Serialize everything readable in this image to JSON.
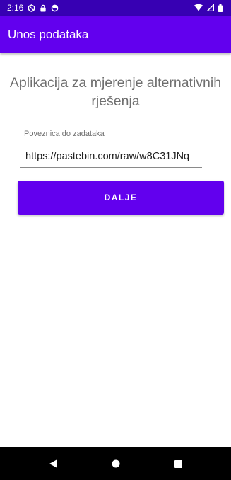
{
  "status_bar": {
    "time": "2:16",
    "icons_left": [
      "location-icon",
      "lock-icon",
      "sync-icon"
    ],
    "icons_right": [
      "wifi-icon",
      "signal-icon",
      "battery-icon"
    ]
  },
  "app_bar": {
    "title": "Unos podataka"
  },
  "main": {
    "heading": "Aplikacija za mjerenje alternativnih rješenja",
    "field_label": "Poveznica do zadataka",
    "url_value": "https://pastebin.com/raw/w8C31JNq",
    "next_button_label": "DALJE"
  },
  "nav_bar": {
    "buttons": [
      "back-icon",
      "home-icon",
      "recents-icon"
    ]
  },
  "colors": {
    "status_bar": "#3700b3",
    "primary": "#6200ee",
    "nav_bar": "#000000"
  }
}
